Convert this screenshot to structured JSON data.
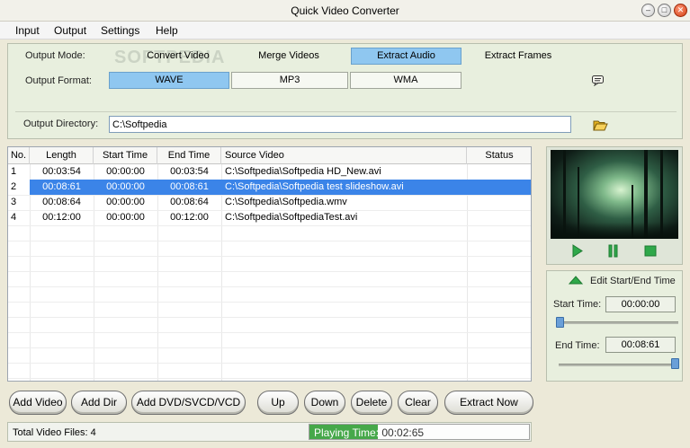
{
  "window": {
    "title": "Quick Video Converter"
  },
  "menu": [
    "Input",
    "Output",
    "Settings",
    "Help"
  ],
  "output_mode": {
    "label": "Output Mode:",
    "options": [
      "Convert Video",
      "Merge Videos",
      "Extract Audio",
      "Extract Frames"
    ],
    "selected": "Extract Audio"
  },
  "output_format": {
    "label": "Output Format:",
    "options": [
      "WAVE",
      "MP3",
      "WMA"
    ],
    "selected": "WAVE"
  },
  "output_directory": {
    "label": "Output Directory:",
    "value": "C:\\Softpedia"
  },
  "watermark": "SOFTPEDIA",
  "table": {
    "columns": [
      "No.",
      "Length",
      "Start Time",
      "End Time",
      "Source Video",
      "Status"
    ],
    "rows": [
      [
        "1",
        "00:03:54",
        "00:00:00",
        "00:03:54",
        "C:\\Softpedia\\Softpedia HD_New.avi",
        ""
      ],
      [
        "2",
        "00:08:61",
        "00:00:00",
        "00:08:61",
        "C:\\Softpedia\\Softpedia test slideshow.avi",
        ""
      ],
      [
        "3",
        "00:08:64",
        "00:00:00",
        "00:08:64",
        "C:\\Softpedia\\Softpedia.wmv",
        ""
      ],
      [
        "4",
        "00:12:00",
        "00:00:00",
        "00:12:00",
        "C:\\Softpedia\\SoftpediaTest.avi",
        ""
      ]
    ],
    "selected_row": 2
  },
  "edit_panel": {
    "header": "Edit Start/End Time",
    "start_label": "Start Time:",
    "start_value": "00:00:00",
    "end_label": "End Time:",
    "end_value": "00:08:61",
    "start_position": 0,
    "end_position": 1
  },
  "buttons": [
    "Add Video",
    "Add Dir",
    "Add DVD/SVCD/VCD",
    "Up",
    "Down",
    "Delete",
    "Clear",
    "Extract Now"
  ],
  "status": {
    "total_label": "Total Video Files: 4",
    "playing_label": "Playing Time:",
    "playing_value": "00:02:65",
    "progress": 0.31
  },
  "colors": {
    "accent": "#8fc7f0",
    "selected_row": "#3b84e8",
    "play_green": "#2fa84a",
    "panel_bg": "#e8efde"
  }
}
